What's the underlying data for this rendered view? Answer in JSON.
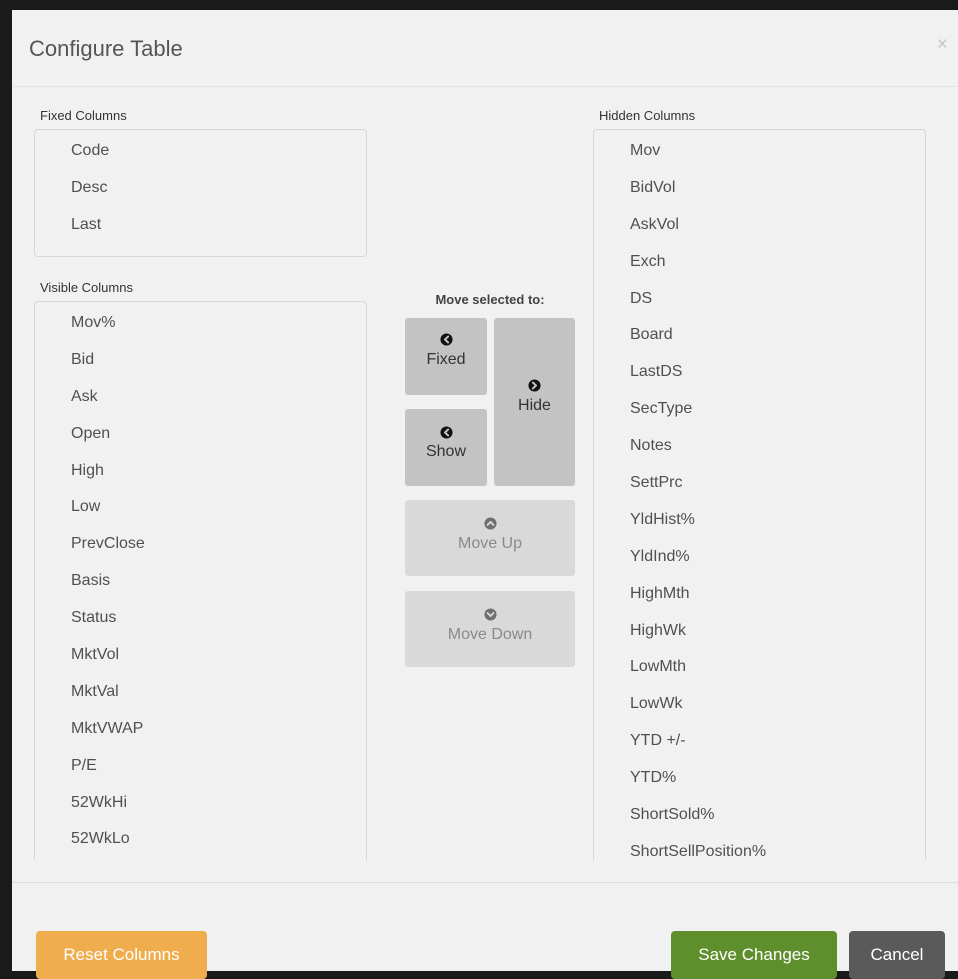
{
  "dialog": {
    "title": "Configure Table",
    "close_label": "×"
  },
  "fixed": {
    "label": "Fixed Columns",
    "items": [
      "Code",
      "Desc",
      "Last"
    ]
  },
  "visible": {
    "label": "Visible Columns",
    "items": [
      "Mov%",
      "Bid",
      "Ask",
      "Open",
      "High",
      "Low",
      "PrevClose",
      "Basis",
      "Status",
      "MktVol",
      "MktVal",
      "MktVWAP",
      "P/E",
      "52WkHi",
      "52WkLo"
    ]
  },
  "hidden": {
    "label": "Hidden Columns",
    "items": [
      "Mov",
      "BidVol",
      "AskVol",
      "Exch",
      "DS",
      "Board",
      "LastDS",
      "SecType",
      "Notes",
      "SettPrc",
      "YldHist%",
      "YldInd%",
      "HighMth",
      "HighWk",
      "LowMth",
      "LowWk",
      "YTD +/-",
      "YTD%",
      "ShortSold%",
      "ShortSellPosition%"
    ]
  },
  "move": {
    "title": "Move selected to:",
    "fixed_label": "Fixed",
    "show_label": "Show",
    "hide_label": "Hide",
    "up_label": "Move Up",
    "down_label": "Move Down"
  },
  "footer": {
    "reset_label": "Reset Columns",
    "save_label": "Save Changes",
    "cancel_label": "Cancel"
  },
  "colors": {
    "reset": "#f0ad4e",
    "save": "#5f8f2c",
    "cancel": "#5a5a5a"
  }
}
